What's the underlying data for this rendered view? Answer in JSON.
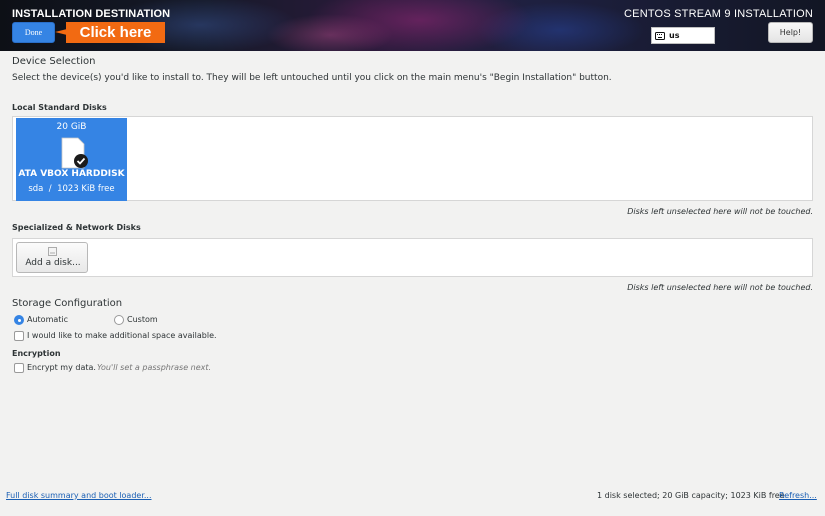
{
  "header": {
    "title": "INSTALLATION DESTINATION",
    "done_label": "Done",
    "callout_label": "Click here",
    "product_title": "CENTOS STREAM 9 INSTALLATION",
    "keyboard_layout": "us",
    "help_label": "Help!"
  },
  "device_selection": {
    "heading": "Device Selection",
    "description": "Select the device(s) you'd like to install to.  They will be left untouched until you click on the main menu's \"Begin Installation\" button."
  },
  "local_disks": {
    "heading": "Local Standard Disks",
    "disks": [
      {
        "size": "20 GiB",
        "name": "ATA VBOX HARDDISK",
        "device": "sda",
        "separator": "/",
        "free": "1023 KiB free",
        "selected": true
      }
    ],
    "note": "Disks left unselected here will not be touched."
  },
  "network_disks": {
    "heading": "Specialized & Network Disks",
    "add_disk_label": "Add a disk...",
    "note": "Disks left unselected here will not be touched."
  },
  "storage_configuration": {
    "heading": "Storage Configuration",
    "automatic_label": "Automatic",
    "custom_label": "Custom",
    "selected": "Automatic",
    "reclaim_label": "I would like to make additional space available."
  },
  "encryption": {
    "heading": "Encryption",
    "encrypt_label": "Encrypt my data.",
    "encrypt_hint": "You'll set a passphrase next."
  },
  "footer": {
    "summary_link": "Full disk summary and boot loader...",
    "status": "1 disk selected; 20 GiB capacity; 1023 KiB free",
    "refresh_link": "Refresh..."
  },
  "colors": {
    "accent": "#3584e4",
    "callout": "#f26a12",
    "background": "#f2f2f1",
    "link": "#1a5fb4"
  },
  "icons": [
    "keyboard-icon",
    "harddisk-icon",
    "checkmark-icon",
    "add-disk-icon"
  ]
}
